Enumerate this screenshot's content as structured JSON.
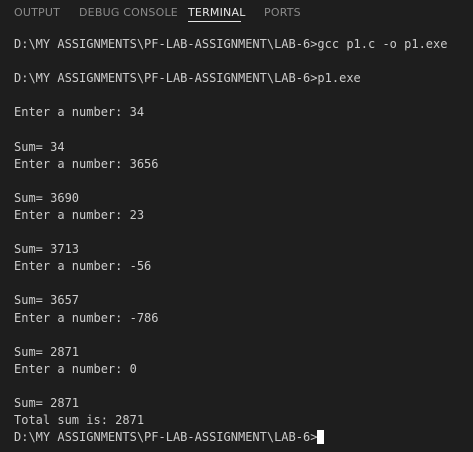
{
  "tabs": [
    {
      "label": "OUTPUT",
      "active": false
    },
    {
      "label": "DEBUG CONSOLE",
      "active": false
    },
    {
      "label": "TERMINAL",
      "active": true
    },
    {
      "label": "PORTS",
      "active": false
    }
  ],
  "terminal": {
    "lines": [
      "D:\\MY ASSIGNMENTS\\PF-LAB-ASSIGNMENT\\LAB-6>gcc p1.c -o p1.exe",
      "",
      "D:\\MY ASSIGNMENTS\\PF-LAB-ASSIGNMENT\\LAB-6>p1.exe",
      "",
      "Enter a number: 34",
      "",
      "Sum= 34",
      "Enter a number: 3656",
      "",
      "Sum= 3690",
      "Enter a number: 23",
      "",
      "Sum= 3713",
      "Enter a number: -56",
      "",
      "Sum= 3657",
      "Enter a number: -786",
      "",
      "Sum= 2871",
      "Enter a number: 0",
      "",
      "Sum= 2871",
      "Total sum is: 2871",
      "D:\\MY ASSIGNMENTS\\PF-LAB-ASSIGNMENT\\LAB-6>"
    ]
  },
  "colors": {
    "background": "#1e1e1e",
    "text": "#cccccc",
    "tab_inactive": "#8b8b8b",
    "tab_active": "#e7e7e7",
    "cursor": "#ffffff"
  }
}
